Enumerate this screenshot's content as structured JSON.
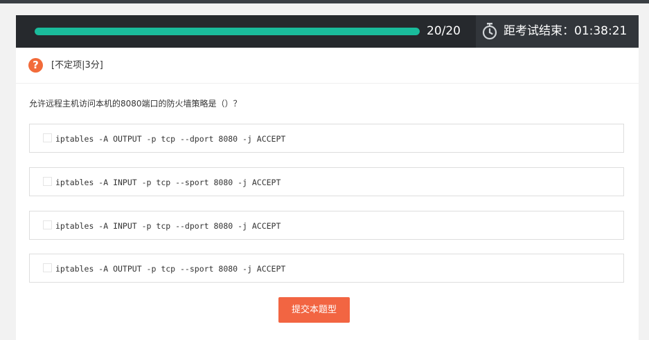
{
  "progress": {
    "count_text": "20/20",
    "fraction": 1.0,
    "color": "#1abc9c"
  },
  "timer": {
    "icon": "stopwatch-icon",
    "text": "距考试结束：01:38:21"
  },
  "question": {
    "type_icon": "question-mark-icon",
    "type_icon_glyph": "?",
    "type_label": "[不定项|3分]",
    "text": "允许远程主机访问本机的8080端口的防火墙策略是（）？",
    "options": [
      {
        "label": "iptables -A OUTPUT -p tcp --dport 8080 -j ACCEPT",
        "checked": false
      },
      {
        "label": "iptables -A INPUT -p tcp --sport 8080 -j ACCEPT",
        "checked": false
      },
      {
        "label": "iptables -A INPUT -p tcp --dport 8080 -j ACCEPT",
        "checked": false
      },
      {
        "label": "iptables -A OUTPUT -p tcp --sport 8080 -j ACCEPT",
        "checked": false
      }
    ]
  },
  "submit": {
    "label": "提交本题型",
    "color": "#f26542"
  }
}
